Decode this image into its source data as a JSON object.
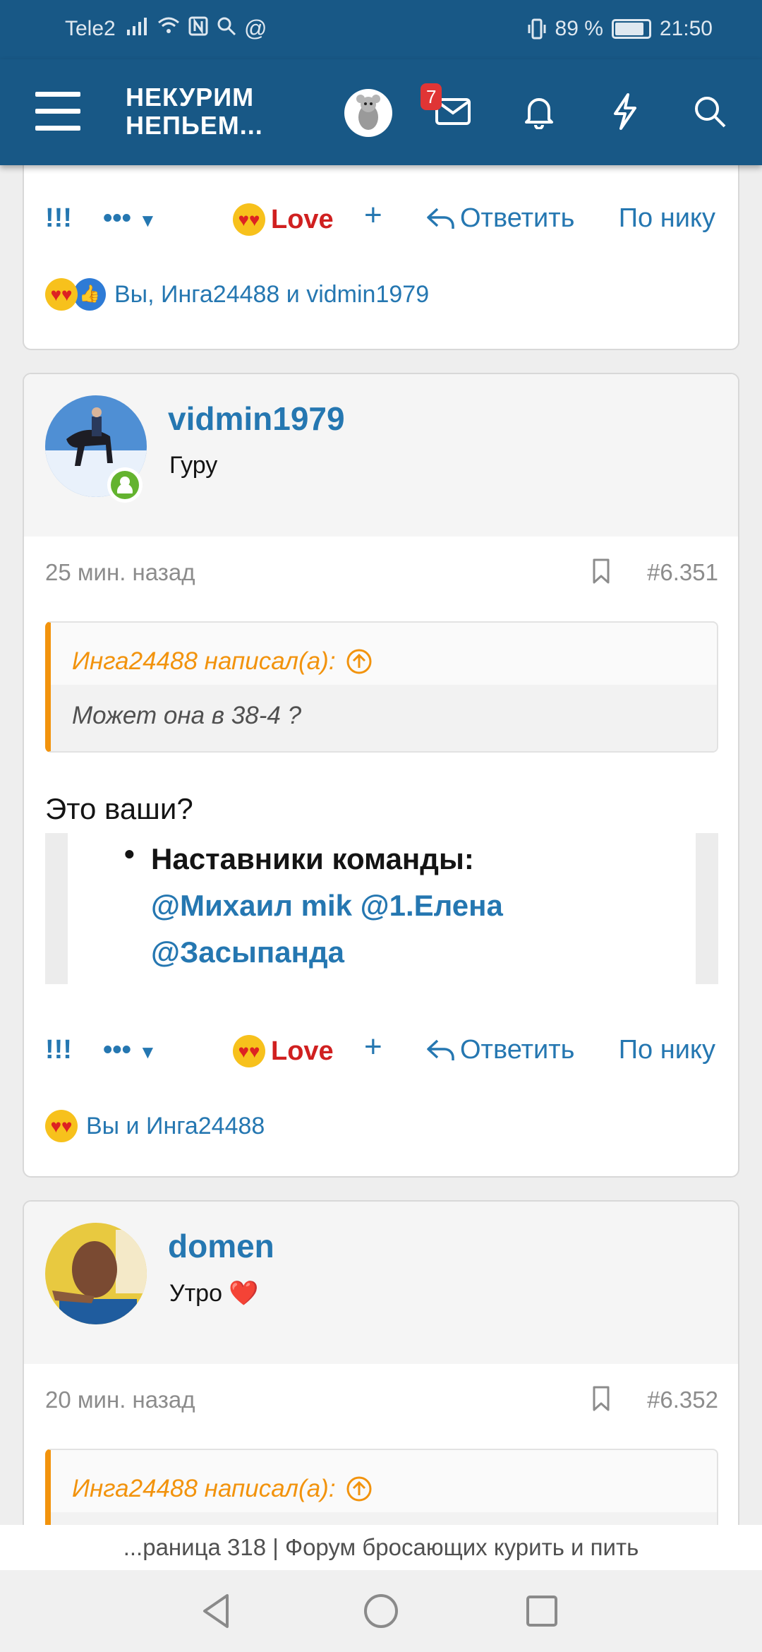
{
  "status_bar": {
    "carrier": "Tele2",
    "battery": "89 %",
    "battery_level": 0.89,
    "time": "21:50"
  },
  "app_bar": {
    "logo_line1": "НЕКУРИМ",
    "logo_line2": "НЕПЬЕМ...",
    "messages_badge": "7",
    "icons": [
      "menu-icon",
      "avatar",
      "mail-icon",
      "bell-icon",
      "lightning-icon",
      "search-icon"
    ]
  },
  "post1": {
    "actions": {
      "bang": "!!!",
      "more": "•••",
      "love": "Love",
      "plus": "+",
      "reply": "Ответить",
      "nick": "По нику"
    },
    "reactions_text": "Вы, Инга24488 и vidmin1979"
  },
  "post2": {
    "username": "vidmin1979",
    "user_title": "Гуру",
    "time": "25 мин. назад",
    "post_number": "#6.351",
    "quote_author": "Инга24488 написал(а):",
    "quote_text": "Может она в 38-4 ?",
    "body": "Это ваши?",
    "embed_heading": "Наставники команды:",
    "embed_mentions_line1": "@Михаил mik @1.Елена",
    "embed_mentions_line2": "@Засыпанда",
    "actions": {
      "bang": "!!!",
      "more": "•••",
      "love": "Love",
      "plus": "+",
      "reply": "Ответить",
      "nick": "По нику"
    },
    "reactions_text": "Вы и Инга24488"
  },
  "post3": {
    "username": "domen",
    "user_title": "Утро ❤️",
    "time": "20 мин. назад",
    "post_number": "#6.352",
    "quote_author": "Инга24488 написал(а):"
  },
  "page_title_bar": "...раница 318 | Форум бросающих курить и пить",
  "colors": {
    "header": "#185886",
    "link": "#2577b1",
    "love": "#d02020",
    "quote_accent": "#f2930d",
    "online": "#63b32f"
  }
}
